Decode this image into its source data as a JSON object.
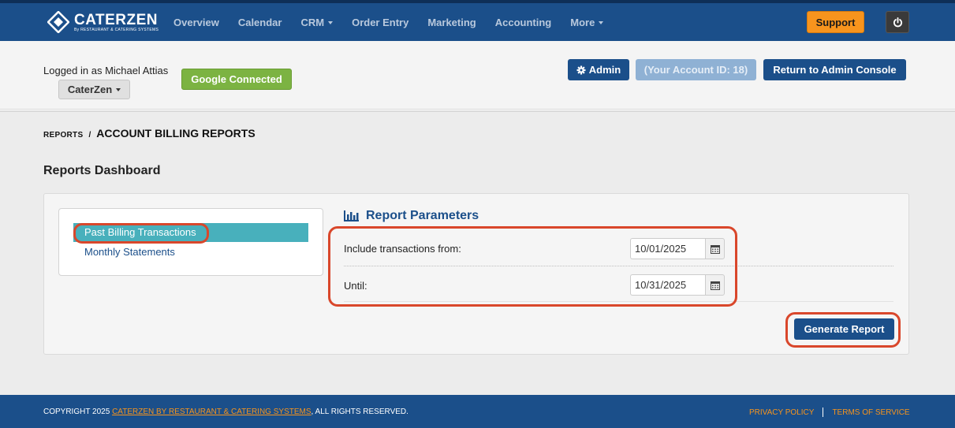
{
  "brand": {
    "name": "CATERZEN",
    "subline": "By RESTAURANT & CATERING SYSTEMS"
  },
  "nav": {
    "items": [
      "Overview",
      "Calendar",
      "CRM",
      "Order Entry",
      "Marketing",
      "Accounting",
      "More"
    ],
    "support_label": "Support",
    "power_icon": "power-icon"
  },
  "account": {
    "logged_in_text": "Logged in as Michael Attias",
    "org_label": "CaterZen",
    "google_label": "Google Connected",
    "admin_label": "Admin",
    "account_id_label": "(Your Account ID: 18)",
    "return_label": "Return to Admin Console"
  },
  "breadcrumb": {
    "parent": "REPORTS",
    "separator": "/",
    "current": "ACCOUNT BILLING REPORTS"
  },
  "page_title": "Reports Dashboard",
  "report_menu": {
    "items": [
      {
        "label": "Past Billing Transactions",
        "active": true
      },
      {
        "label": "Monthly Statements",
        "active": false
      }
    ]
  },
  "parameters": {
    "title": "Report Parameters",
    "from_label": "Include transactions from:",
    "from_value": "10/01/2025",
    "until_label": "Until:",
    "until_value": "10/31/2025",
    "generate_label": "Generate Report"
  },
  "footer": {
    "copyright_prefix": "COPYRIGHT 2025 ",
    "company_link": "CATERZEN BY RESTAURANT & CATERING SYSTEMS",
    "copyright_suffix": ", ALL RIGHTS RESERVED.",
    "privacy": "PRIVACY POLICY",
    "terms": "TERMS OF SERVICE"
  },
  "colors": {
    "nav_bg": "#1b4f8a",
    "accent_orange": "#f7941d",
    "google_green": "#7cb342",
    "active_teal": "#48b0bc",
    "annotation_red": "#d9472b"
  }
}
